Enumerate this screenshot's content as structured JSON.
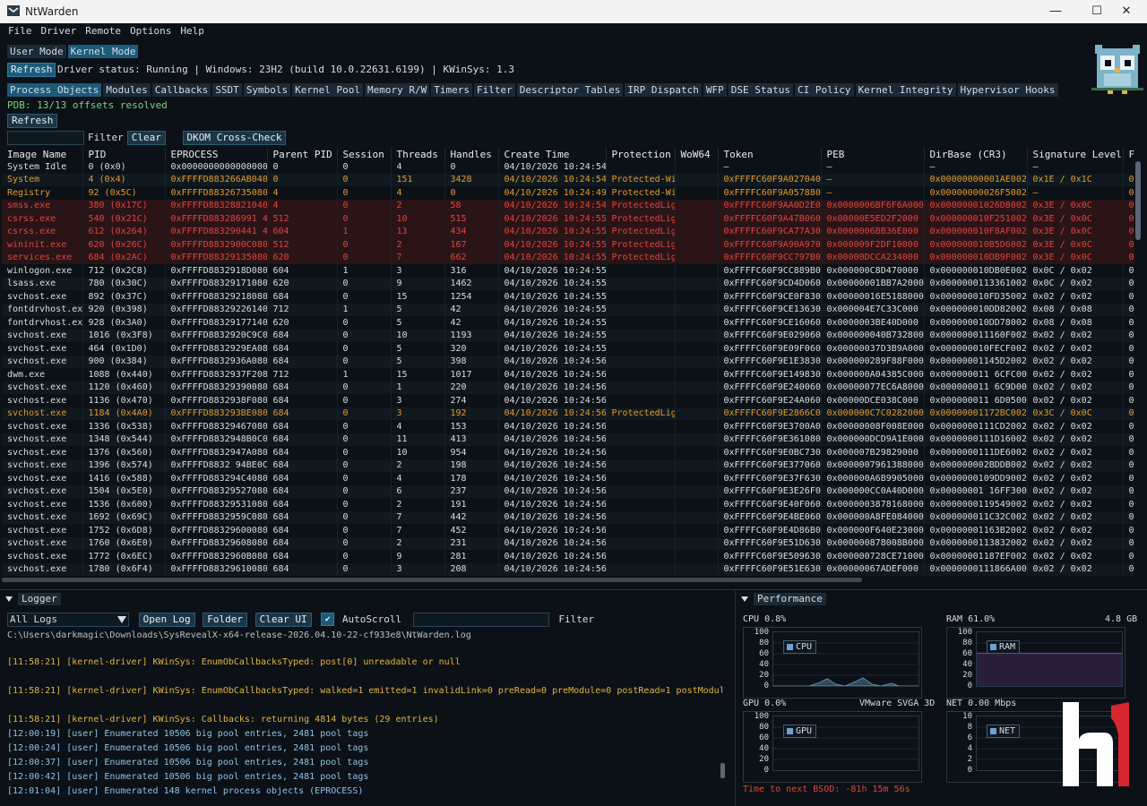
{
  "window": {
    "title": "NtWarden"
  },
  "menu": [
    "File",
    "Driver",
    "Remote",
    "Options",
    "Help"
  ],
  "mode_tabs": [
    {
      "label": "User Mode"
    },
    {
      "label": "Kernel Mode",
      "active": true
    }
  ],
  "status": {
    "refresh_label": "Refresh",
    "text": "Driver status: Running | Windows: 23H2 (build 10.0.22631.6199) | KWinSys: 1.3"
  },
  "feature_tabs": [
    "Process Objects",
    "Modules",
    "Callbacks",
    "SSDT",
    "Symbols",
    "Kernel Pool",
    "Memory R/W",
    "Timers",
    "Filter",
    "Descriptor Tables",
    "IRP Dispatch",
    "WFP",
    "DSE Status",
    "CI Policy",
    "Kernel Integrity",
    "Hypervisor Hooks"
  ],
  "pdb_status": "PDB: 13/13 offsets resolved",
  "refresh2_label": "Refresh",
  "filterbar": {
    "filter_label": "Filter",
    "clear_label": "Clear",
    "dkom_label": "DKOM Cross-Check"
  },
  "columns": [
    "Image Name",
    "PID",
    "EPROCESS",
    "Parent PID",
    "Session",
    "Threads",
    "Handles",
    "Create Time",
    "Protection",
    "WoW64",
    "Token",
    "PEB",
    "DirBase (CR3)",
    "Signature Level",
    "F"
  ],
  "rows": [
    {
      "c": [
        "System Idle",
        "0 (0x0)",
        "0x0000000000000000",
        "0",
        "0",
        "4",
        "0",
        "04/10/2026 10:24:54",
        "",
        "",
        "–",
        "–",
        "–",
        "–",
        ""
      ],
      "style": ""
    },
    {
      "c": [
        "System",
        "4 (0x4)",
        "0xFFFFD883266AB040",
        "0",
        "0",
        "151",
        "3428",
        "04/10/2026 10:24:54",
        "Protected-Wi",
        "",
        "0xFFFFC60F9A027040",
        "–",
        "0x00000000001AE002",
        "0x1E / 0x1C",
        "0"
      ],
      "style": "orange"
    },
    {
      "c": [
        "Registry",
        "92 (0x5C)",
        "0xFFFFD88326735080",
        "4",
        "0",
        "4",
        "0",
        "04/10/2026 10:24:49",
        "Protected-Wi",
        "",
        "0xFFFFC60F9A057880",
        "–",
        "0x00000000026F5002",
        "–",
        "0"
      ],
      "style": "orange"
    },
    {
      "c": [
        "smss.exe",
        "380 (0x17C)",
        "0xFFFFD88328821040",
        "4",
        "0",
        "2",
        "58",
        "04/10/2026 10:24:54",
        "ProtectedLig",
        "",
        "0xFFFFC60F9AA0D2E0",
        "0x0000006BF6F6A000",
        "0x00000001026D8002",
        "0x3E / 0x0C",
        "0"
      ],
      "style": "red"
    },
    {
      "c": [
        "csrss.exe",
        "540 (0x21C)",
        "0xFFFFD883286991 40",
        "512",
        "0",
        "10",
        "515",
        "04/10/2026 10:24:55",
        "ProtectedLig",
        "",
        "0xFFFFC60F9A47B060",
        "0x00000E5ED2F2000",
        "0x000000010F251002",
        "0x3E / 0x0C",
        "0"
      ],
      "style": "red"
    },
    {
      "c": [
        "csrss.exe",
        "612 (0x264)",
        "0xFFFFD883290441 40",
        "604",
        "1",
        "13",
        "434",
        "04/10/2026 10:24:55",
        "ProtectedLig",
        "",
        "0xFFFFC60F9CA77A30",
        "0x0000006BB36E000",
        "0x000000010F8AF002",
        "0x3E / 0x0C",
        "0"
      ],
      "style": "red"
    },
    {
      "c": [
        "wininit.exe",
        "620 (0x26C)",
        "0xFFFFD8832900C080",
        "512",
        "0",
        "2",
        "167",
        "04/10/2026 10:24:55",
        "ProtectedLig",
        "",
        "0xFFFFC60F9A90A970",
        "0x000009F2DF10000",
        "0x000000010B5D6002",
        "0x3E / 0x0C",
        "0"
      ],
      "style": "red"
    },
    {
      "c": [
        "services.exe",
        "684 (0x2AC)",
        "0xFFFFD88329135080",
        "620",
        "0",
        "7",
        "662",
        "04/10/2026 10:24:55",
        "ProtectedLig",
        "",
        "0xFFFFC60F9CC797B0",
        "0x00000DCCA234000",
        "0x000000010DB9F002",
        "0x3E / 0x0C",
        "0"
      ],
      "style": "red"
    },
    {
      "c": [
        "winlogon.exe",
        "712 (0x2C8)",
        "0xFFFFD8832918D080",
        "604",
        "1",
        "3",
        "316",
        "04/10/2026 10:24:55",
        "",
        "",
        "0xFFFFC60F9CC889B0",
        "0x000000C8D470000",
        "0x000000010DB0E002",
        "0x0C / 0x02",
        "0"
      ],
      "style": ""
    },
    {
      "c": [
        "lsass.exe",
        "780 (0x30C)",
        "0xFFFFD88329171080",
        "620",
        "0",
        "9",
        "1462",
        "04/10/2026 10:24:55",
        "",
        "",
        "0xFFFFC60F9CD4D060",
        "0x00000001BB7A2000",
        "0x0000000113361002",
        "0x0C / 0x02",
        "0"
      ],
      "style": ""
    },
    {
      "c": [
        "svchost.exe",
        "892 (0x37C)",
        "0xFFFFD88329218080",
        "684",
        "0",
        "15",
        "1254",
        "04/10/2026 10:24:55",
        "",
        "",
        "0xFFFFC60F9CE0F830",
        "0x00000016E5188000",
        "0x000000010FD35002",
        "0x02 / 0x02",
        "0"
      ],
      "style": ""
    },
    {
      "c": [
        "fontdrvhost.ex",
        "920 (0x398)",
        "0xFFFFD88329226140",
        "712",
        "1",
        "5",
        "42",
        "04/10/2026 10:24:55",
        "",
        "",
        "0xFFFFC60F9CE13630",
        "0x000004E7C33C000",
        "0x000000010DD82002",
        "0x08 / 0x08",
        "0"
      ],
      "style": ""
    },
    {
      "c": [
        "fontdrvhost.ex",
        "928 (0x3A0)",
        "0xFFFFD88329177140",
        "620",
        "0",
        "5",
        "42",
        "04/10/2026 10:24:55",
        "",
        "",
        "0xFFFFC60F9CE16060",
        "0x0000003BE40D000",
        "0x000000010DD78002",
        "0x08 / 0x08",
        "0"
      ],
      "style": ""
    },
    {
      "c": [
        "svchost.exe",
        "1016 (0x3F8)",
        "0xFFFFD8832920C9C0",
        "684",
        "0",
        "10",
        "1193",
        "04/10/2026 10:24:55",
        "",
        "",
        "0xFFFFC60F9E029060",
        "0x000000040B7328000",
        "0x000000011160F002",
        "0x02 / 0x02",
        "0"
      ],
      "style": ""
    },
    {
      "c": [
        "svchost.exe",
        "464 (0x1D0)",
        "0xFFFFD8832929EA080",
        "684",
        "0",
        "5",
        "320",
        "04/10/2026 10:24:55",
        "",
        "",
        "0xFFFFC60F9E09F060",
        "0x00000037D3B9A000",
        "0x000000010FECF002",
        "0x02 / 0x02",
        "0"
      ],
      "style": ""
    },
    {
      "c": [
        "svchost.exe",
        "900 (0x384)",
        "0xFFFFD8832936A080",
        "684",
        "0",
        "5",
        "398",
        "04/10/2026 10:24:56",
        "",
        "",
        "0xFFFFC60F9E1E3830",
        "0x000000289F88F000",
        "0x00000001145D2002",
        "0x02 / 0x02",
        "0"
      ],
      "style": ""
    },
    {
      "c": [
        "dwm.exe",
        "1088 (0x440)",
        "0xFFFFD8832937F2080",
        "712",
        "1",
        "15",
        "1017",
        "04/10/2026 10:24:56",
        "",
        "",
        "0xFFFFC60F9E149830",
        "0x000000A04385C000",
        "0x000000011 6CFC002",
        "0x02 / 0x02",
        "0"
      ],
      "style": ""
    },
    {
      "c": [
        "svchost.exe",
        "1120 (0x460)",
        "0xFFFFD88329390080",
        "684",
        "0",
        "1",
        "220",
        "04/10/2026 10:24:56",
        "",
        "",
        "0xFFFFC60F9E240060",
        "0x00000077EC6A8000",
        "0x000000011 6C9D002",
        "0x02 / 0x02",
        "0"
      ],
      "style": ""
    },
    {
      "c": [
        "svchost.exe",
        "1136 (0x470)",
        "0xFFFFD8832938F080",
        "684",
        "0",
        "3",
        "274",
        "04/10/2026 10:24:56",
        "",
        "",
        "0xFFFFC60F9E24A060",
        "0x00000DCE038C000",
        "0x000000011 6D05002",
        "0x02 / 0x02",
        "0"
      ],
      "style": ""
    },
    {
      "c": [
        "svchost.exe",
        "1184 (0x4A0)",
        "0xFFFFD883293BE080",
        "684",
        "0",
        "3",
        "192",
        "04/10/2026 10:24:56",
        "ProtectedLig",
        "",
        "0xFFFFC60F9E2866C0",
        "0x000000C7C0282000",
        "0x00000001172BC002",
        "0x3C / 0x0C",
        "0"
      ],
      "style": "orange"
    },
    {
      "c": [
        "svchost.exe",
        "1336 (0x538)",
        "0xFFFFD88329467080",
        "684",
        "0",
        "4",
        "153",
        "04/10/2026 10:24:56",
        "",
        "",
        "0xFFFFC60F9E3700A0",
        "0x00000008F008E000",
        "0x0000000111CD2002",
        "0x02 / 0x02",
        "0"
      ],
      "style": ""
    },
    {
      "c": [
        "svchost.exe",
        "1348 (0x544)",
        "0xFFFFD8832948B0C0",
        "684",
        "0",
        "11",
        "413",
        "04/10/2026 10:24:56",
        "",
        "",
        "0xFFFFC60F9E361080",
        "0x000000DCD9A1E000",
        "0x0000000111D16002",
        "0x02 / 0x02",
        "0"
      ],
      "style": ""
    },
    {
      "c": [
        "svchost.exe",
        "1376 (0x560)",
        "0xFFFFD8832947A080",
        "684",
        "0",
        "10",
        "954",
        "04/10/2026 10:24:56",
        "",
        "",
        "0xFFFFC60F9E0BC730",
        "0x000007B29829000",
        "0x0000000111DE6002",
        "0x02 / 0x02",
        "0"
      ],
      "style": ""
    },
    {
      "c": [
        "svchost.exe",
        "1396 (0x574)",
        "0xFFFFD8832 94BE0C0",
        "684",
        "0",
        "2",
        "198",
        "04/10/2026 10:24:56",
        "",
        "",
        "0xFFFFC60F9E377060",
        "0x0000007961388000",
        "0x000000002BDDB002",
        "0x02 / 0x02",
        "0"
      ],
      "style": ""
    },
    {
      "c": [
        "svchost.exe",
        "1416 (0x588)",
        "0xFFFFD883294C4080",
        "684",
        "0",
        "4",
        "178",
        "04/10/2026 10:24:56",
        "",
        "",
        "0xFFFFC60F9E37F630",
        "0x000000A6B9905000",
        "0x0000000109DD9002",
        "0x02 / 0x02",
        "0"
      ],
      "style": ""
    },
    {
      "c": [
        "svchost.exe",
        "1504 (0x5E0)",
        "0xFFFFD88329527080",
        "684",
        "0",
        "6",
        "237",
        "04/10/2026 10:24:56",
        "",
        "",
        "0xFFFFC60F9E3E26F0",
        "0x000000CC0A40D000",
        "0x00000001 16FF3002",
        "0x02 / 0x02",
        "0"
      ],
      "style": ""
    },
    {
      "c": [
        "svchost.exe",
        "1536 (0x600)",
        "0xFFFFD88329531080",
        "684",
        "0",
        "2",
        "191",
        "04/10/2026 10:24:56",
        "",
        "",
        "0xFFFFC60F9E40F060",
        "0x0000003878168000",
        "0x0000000119549002",
        "0x02 / 0x02",
        "0"
      ],
      "style": ""
    },
    {
      "c": [
        "svchost.exe",
        "1692 (0x69C)",
        "0xFFFFD8832959C080",
        "684",
        "0",
        "7",
        "442",
        "04/10/2026 10:24:56",
        "",
        "",
        "0xFFFFC60F9E4BE060",
        "0x000000A8FE084000",
        "0x000000011C32C002",
        "0x02 / 0x02",
        "0"
      ],
      "style": ""
    },
    {
      "c": [
        "svchost.exe",
        "1752 (0x6D8)",
        "0xFFFFD88329600080",
        "684",
        "0",
        "7",
        "452",
        "04/10/2026 10:24:56",
        "",
        "",
        "0xFFFFC60F9E4D86B0",
        "0x000000F640E23000",
        "0x00000001163B2002",
        "0x02 / 0x02",
        "0"
      ],
      "style": ""
    },
    {
      "c": [
        "svchost.exe",
        "1760 (0x6E0)",
        "0xFFFFD88329608080",
        "684",
        "0",
        "2",
        "231",
        "04/10/2026 10:24:56",
        "",
        "",
        "0xFFFFC60F9E51D630",
        "0x000000878008B000",
        "0x0000000113832002",
        "0x02 / 0x02",
        "0"
      ],
      "style": ""
    },
    {
      "c": [
        "svchost.exe",
        "1772 (0x6EC)",
        "0xFFFFD8832960B080",
        "684",
        "0",
        "9",
        "281",
        "04/10/2026 10:24:56",
        "",
        "",
        "0xFFFFC60F9E509630",
        "0x000000728CE71000",
        "0x00000001187EF002",
        "0x02 / 0x02",
        "0"
      ],
      "style": ""
    },
    {
      "c": [
        "svchost.exe",
        "1780 (0x6F4)",
        "0xFFFFD88329610080",
        "684",
        "0",
        "3",
        "208",
        "04/10/2026 10:24:56",
        "",
        "",
        "0xFFFFC60F9E51E630",
        "0x00000067ADEF000",
        "0x0000000111866A002",
        "0x02 / 0x02",
        "0"
      ],
      "style": ""
    }
  ],
  "logger": {
    "title": "Logger",
    "select_value": "All Logs",
    "open_log": "Open Log",
    "folder": "Folder",
    "clear_ui": "Clear UI",
    "autoscroll": "AutoScroll",
    "filter_label": "Filter",
    "path": "C:\\Users\\darkmagic\\Downloads\\SysRevealX-x64-release-2026.04.10-22-cf933e8\\NtWarden.log",
    "lines": [
      {
        "t": "[11:58:21] [kernel-driver] KWinSys: EnumObCallbacksTyped: post[0] unreadable or null",
        "k": "warn"
      },
      {
        "t": "",
        "k": ""
      },
      {
        "t": "[11:58:21] [kernel-driver] KWinSys: EnumObCallbacksTyped: walked=1 emitted=1 invalidLink=0 preRead=0 preModule=0 postRead=1 postModul",
        "k": "warn"
      },
      {
        "t": "",
        "k": ""
      },
      {
        "t": "[11:58:21] [kernel-driver] KWinSys: Callbacks: returning 4814 bytes (29 entries)",
        "k": "warn"
      },
      {
        "t": "[12:00:19] [user] Enumerated 10506 big pool entries, 2481 pool tags",
        "k": "info"
      },
      {
        "t": "[12:00:24] [user] Enumerated 10506 big pool entries, 2481 pool tags",
        "k": "info"
      },
      {
        "t": "[12:00:37] [user] Enumerated 10506 big pool entries, 2481 pool tags",
        "k": "info"
      },
      {
        "t": "[12:00:42] [user] Enumerated 10506 big pool entries, 2481 pool tags",
        "k": "info"
      },
      {
        "t": "[12:01:04] [user] Enumerated 148 kernel process objects (EPROCESS)",
        "k": "info"
      }
    ]
  },
  "performance": {
    "title": "Performance",
    "cpu": {
      "label": "CPU 0.8%",
      "legend": "CPU",
      "value": 0.8
    },
    "ram": {
      "label": "RAM 61.0%",
      "right": "4.8 GB",
      "legend": "RAM",
      "value": 61.0
    },
    "gpu": {
      "label": "GPU 0.0%",
      "right": "VMware SVGA 3D",
      "legend": "GPU",
      "value": 0.0
    },
    "net": {
      "label": "NET 0.00 Mbps",
      "legend": "NET",
      "value": 0.0
    },
    "axis_100": [
      "100",
      "80",
      "60",
      "40",
      "20",
      "0"
    ],
    "axis_10": [
      "10",
      "8",
      "6",
      "4",
      "2",
      "0"
    ],
    "bsod": "Time to next BSOD: -81h 15m 56s"
  },
  "colors": {
    "accent": "#1c5a7a",
    "orange": "#e39a2e",
    "red": "#e0453e",
    "bg": "#0b1116"
  }
}
